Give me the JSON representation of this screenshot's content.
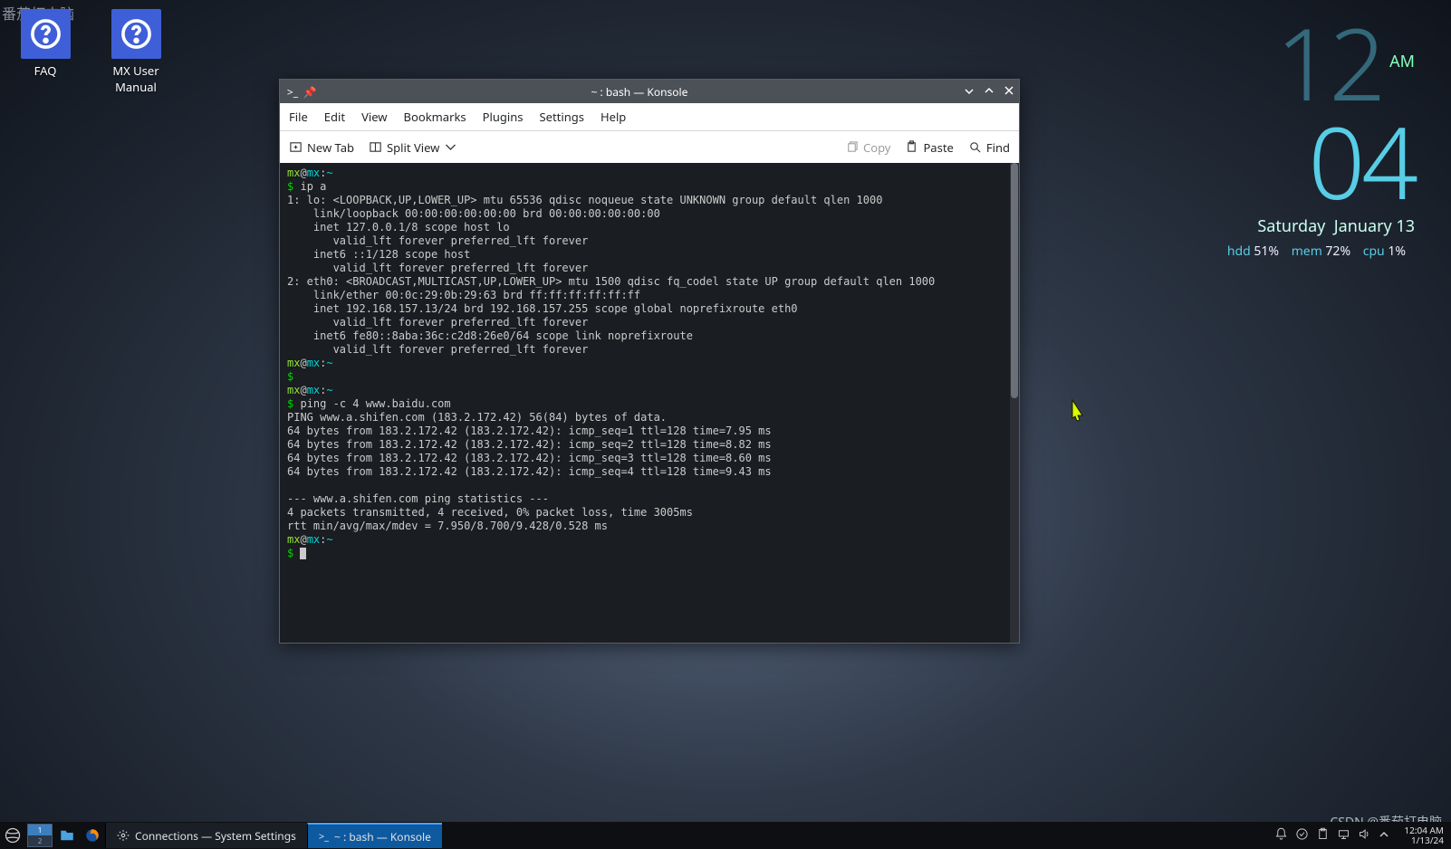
{
  "watermarks": {
    "top_left": "番茄打电脑",
    "bottom_right": "CSDN @番茄打电脑"
  },
  "desktop_icons": {
    "faq": "FAQ",
    "manual": "MX User Manual"
  },
  "clock": {
    "hours": "12",
    "minutes": "04",
    "ampm": "AM",
    "day": "Saturday",
    "date": "January 13",
    "stats": {
      "hdd_label": "hdd",
      "hdd_value": "51%",
      "mem_label": "mem",
      "mem_value": "72%",
      "cpu_label": "cpu",
      "cpu_value": "1%"
    }
  },
  "window": {
    "title": "~ : bash — Konsole",
    "menu": {
      "file": "File",
      "edit": "Edit",
      "view": "View",
      "bookmarks": "Bookmarks",
      "plugins": "Plugins",
      "settings": "Settings",
      "help": "Help"
    },
    "toolbar": {
      "new_tab": "New Tab",
      "split_view": "Split View",
      "copy": "Copy",
      "paste": "Paste",
      "find": "Find"
    },
    "terminal": {
      "prompt_user": "mx",
      "prompt_at": "@",
      "prompt_host": "mx",
      "prompt_colon": ":",
      "prompt_path": "~",
      "prompt_sym": "$",
      "cmd1": "ip a",
      "out1": "1: lo: <LOOPBACK,UP,LOWER_UP> mtu 65536 qdisc noqueue state UNKNOWN group default qlen 1000\n    link/loopback 00:00:00:00:00:00 brd 00:00:00:00:00:00\n    inet 127.0.0.1/8 scope host lo\n       valid_lft forever preferred_lft forever\n    inet6 ::1/128 scope host\n       valid_lft forever preferred_lft forever\n2: eth0: <BROADCAST,MULTICAST,UP,LOWER_UP> mtu 1500 qdisc fq_codel state UP group default qlen 1000\n    link/ether 00:0c:29:0b:29:63 brd ff:ff:ff:ff:ff:ff\n    inet 192.168.157.13/24 brd 192.168.157.255 scope global noprefixroute eth0\n       valid_lft forever preferred_lft forever\n    inet6 fe80::8aba:36c:c2d8:26e0/64 scope link noprefixroute\n       valid_lft forever preferred_lft forever",
      "cmd2": "",
      "cmd3": "ping -c 4 www.baidu.com",
      "out3": "PING www.a.shifen.com (183.2.172.42) 56(84) bytes of data.\n64 bytes from 183.2.172.42 (183.2.172.42): icmp_seq=1 ttl=128 time=7.95 ms\n64 bytes from 183.2.172.42 (183.2.172.42): icmp_seq=2 ttl=128 time=8.82 ms\n64 bytes from 183.2.172.42 (183.2.172.42): icmp_seq=3 ttl=128 time=8.60 ms\n64 bytes from 183.2.172.42 (183.2.172.42): icmp_seq=4 ttl=128 time=9.43 ms\n\n--- www.a.shifen.com ping statistics ---\n4 packets transmitted, 4 received, 0% packet loss, time 3005ms\nrtt min/avg/max/mdev = 7.950/8.700/9.428/0.528 ms"
    }
  },
  "taskbar": {
    "task_settings": "Connections  — System Settings",
    "task_konsole": "~ : bash — Konsole",
    "clock_time": "12:04 AM",
    "clock_date": "1/13/24"
  }
}
